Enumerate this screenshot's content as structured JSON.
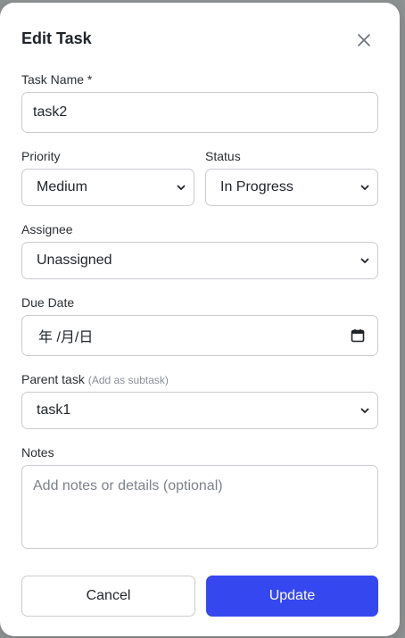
{
  "dialog": {
    "title": "Edit Task",
    "close_icon": "close-icon"
  },
  "task_name": {
    "label": "Task Name *",
    "value": "task2"
  },
  "priority": {
    "label": "Priority",
    "selected": "Medium"
  },
  "status": {
    "label": "Status",
    "selected": "In Progress"
  },
  "assignee": {
    "label": "Assignee",
    "selected": "Unassigned"
  },
  "due_date": {
    "label": "Due Date",
    "placeholder": "年 /月/日",
    "icon": "calendar-icon"
  },
  "parent_task": {
    "label": "Parent task",
    "hint": "(Add as subtask)",
    "selected": "task1"
  },
  "notes": {
    "label": "Notes",
    "placeholder": "Add notes or details (optional)"
  },
  "buttons": {
    "cancel": "Cancel",
    "update": "Update"
  },
  "colors": {
    "primary": "#3548ef",
    "border": "#c9ccd1",
    "text": "#1f2328",
    "placeholder": "#7d8288"
  }
}
